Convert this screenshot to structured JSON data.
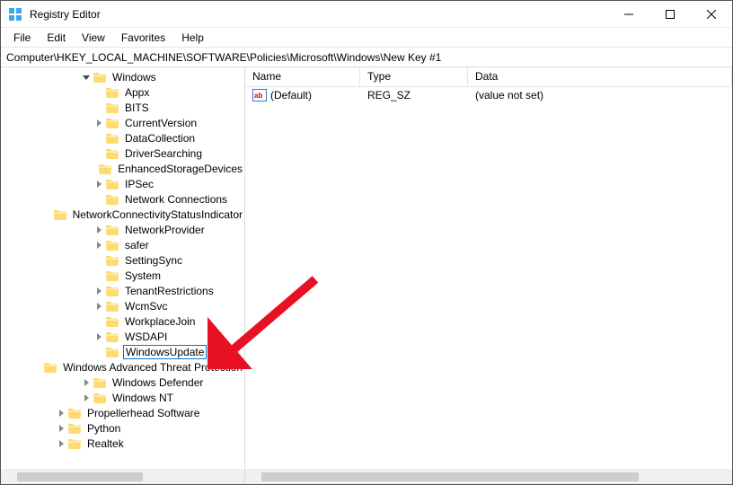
{
  "app": {
    "title": "Registry Editor"
  },
  "window_controls": {
    "min": "minimize",
    "max": "maximize",
    "close": "close"
  },
  "menu": {
    "file": "File",
    "edit": "Edit",
    "view": "View",
    "favorites": "Favorites",
    "help": "Help"
  },
  "address": "Computer\\HKEY_LOCAL_MACHINE\\SOFTWARE\\Policies\\Microsoft\\Windows\\New Key #1",
  "tree": {
    "windows": "Windows",
    "items": {
      "Appx": "Appx",
      "BITS": "BITS",
      "CurrentVersion": "CurrentVersion",
      "DataCollection": "DataCollection",
      "DriverSearching": "DriverSearching",
      "EnhancedStorageDevices": "EnhancedStorageDevices",
      "IPSec": "IPSec",
      "NetworkConnections": "Network Connections",
      "NetworkConnectivityStatus": "NetworkConnectivityStatusIndicator",
      "NetworkProvider": "NetworkProvider",
      "safer": "safer",
      "SettingSync": "SettingSync",
      "System": "System",
      "TenantRestrictions": "TenantRestrictions",
      "WcmSvc": "WcmSvc",
      "WorkplaceJoin": "WorkplaceJoin",
      "WSDAPI": "WSDAPI",
      "WindowsUpdate": "WindowsUpdate"
    },
    "siblings": {
      "WindowsAdvancedThreat": "Windows Advanced Threat Protection",
      "WindowsDefender": "Windows Defender",
      "WindowsNT": "Windows NT"
    },
    "vendors": {
      "Propellerhead": "Propellerhead Software",
      "Python": "Python",
      "Realtek": "Realtek"
    }
  },
  "list": {
    "headers": {
      "name": "Name",
      "type": "Type",
      "data": "Data"
    },
    "rows": [
      {
        "name": "(Default)",
        "type": "REG_SZ",
        "data": "(value not set)"
      }
    ]
  }
}
